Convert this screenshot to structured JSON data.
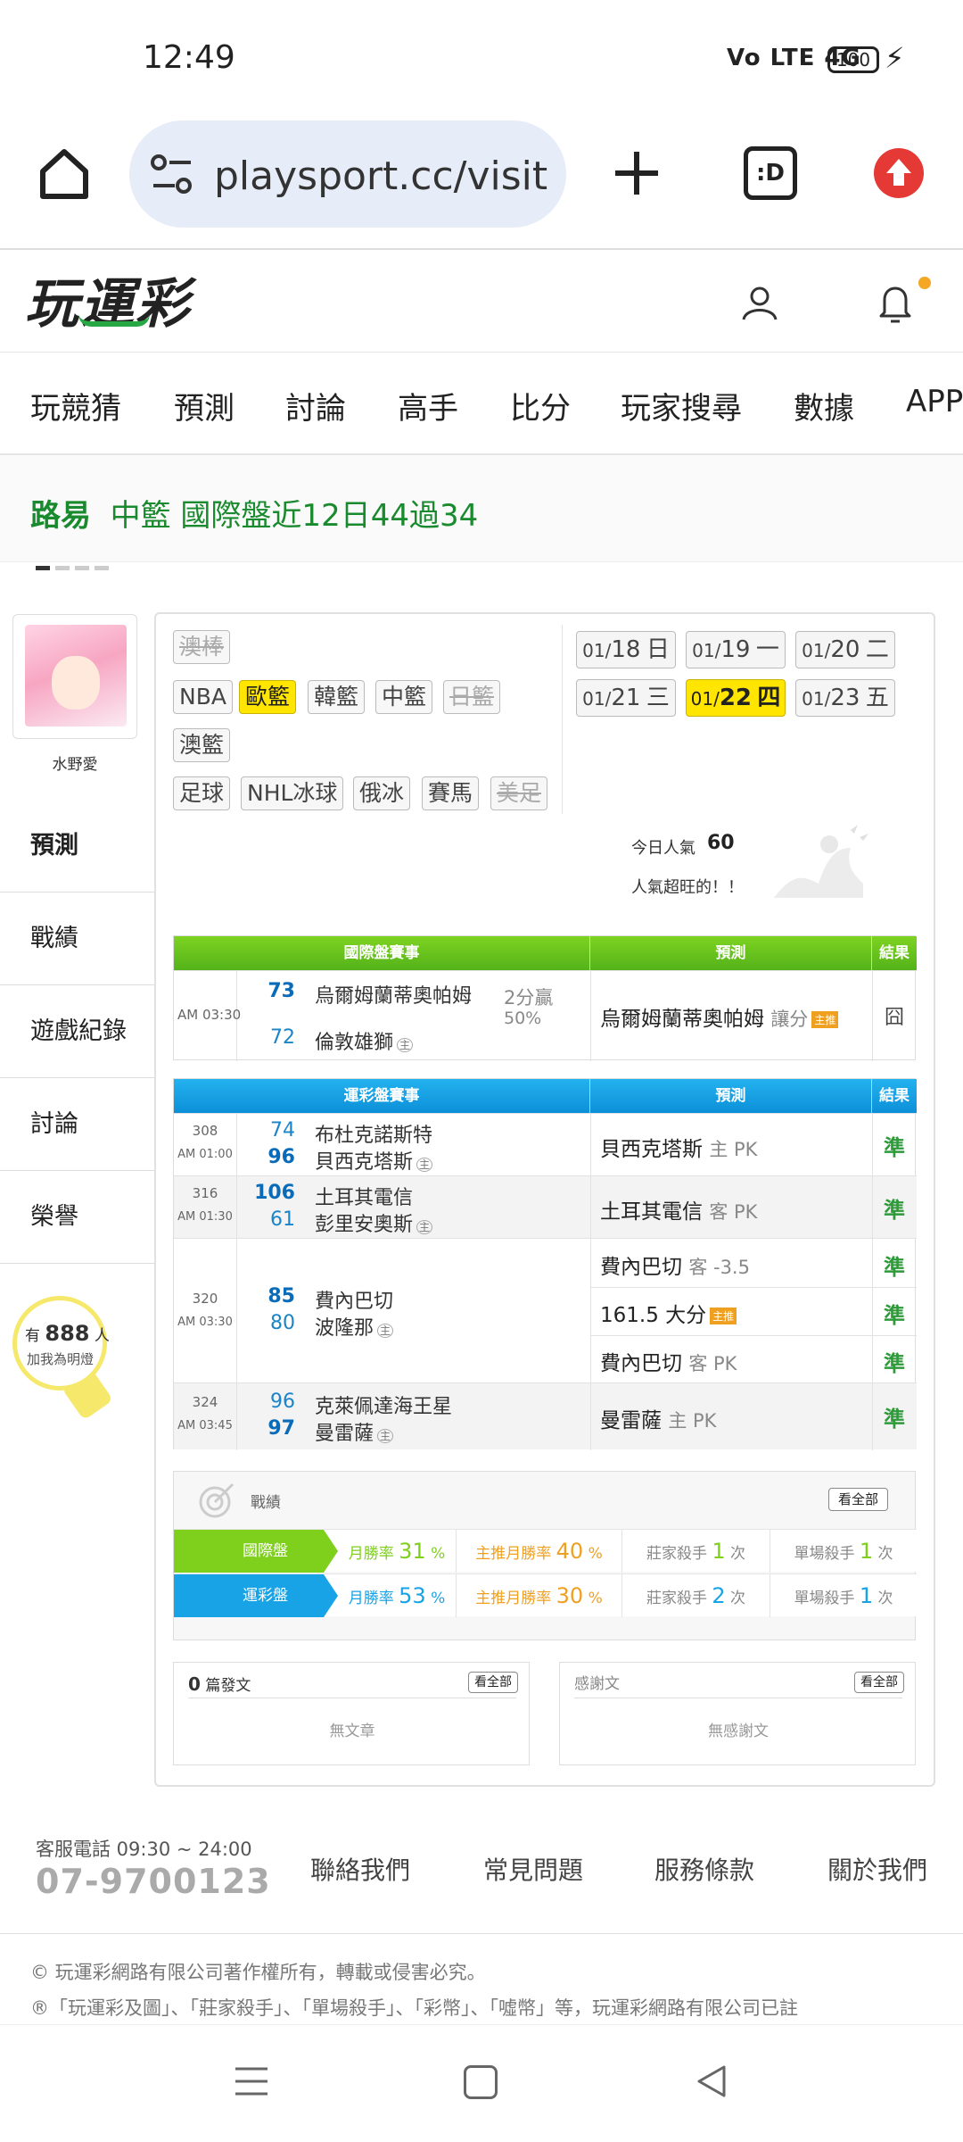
{
  "status_bar": {
    "time": "12:49",
    "signal": "Vo LTE 4G",
    "battery": "100"
  },
  "browser": {
    "url": "playsport.cc/visit"
  },
  "site": {
    "logo": "玩運彩"
  },
  "nav": [
    "玩競猜",
    "預測",
    "討論",
    "高手",
    "比分",
    "玩家搜尋",
    "數據",
    "APP"
  ],
  "marquee": {
    "prefix": "路易",
    "text": "中籃 國際盤近12日44過34"
  },
  "profile": {
    "name": "水野愛",
    "menu": [
      "預測",
      "戰績",
      "遊戲紀錄",
      "討論",
      "榮譽"
    ],
    "fans_prefix": "有",
    "fans_count": "888",
    "fans_suffix": "人",
    "fans_note": "加我為明燈"
  },
  "sports": {
    "row1": [
      "澳棒"
    ],
    "row2": [
      "NBA",
      "歐籃",
      "韓籃",
      "中籃",
      "日籃"
    ],
    "row3": [
      "澳籃"
    ],
    "row4": [
      "足球",
      "NHL冰球",
      "俄冰",
      "賽馬",
      "美足"
    ]
  },
  "dates": [
    {
      "md": "01/",
      "d": "18",
      "w": "日"
    },
    {
      "md": "01/",
      "d": "19",
      "w": "一"
    },
    {
      "md": "01/",
      "d": "20",
      "w": "二"
    },
    {
      "md": "01/",
      "d": "21",
      "w": "三"
    },
    {
      "md": "01/",
      "d": "22",
      "w": "四"
    },
    {
      "md": "01/",
      "d": "23",
      "w": "五"
    }
  ],
  "popularity": {
    "label": "今日人氣",
    "value": "60",
    "note": "人氣超旺的！！"
  },
  "intl_table": {
    "headers": [
      "國際盤賽事",
      "預測",
      "結果"
    ],
    "rows": [
      {
        "time": "AM 03:30",
        "away_score": "73",
        "away_team": "烏爾姆蘭蒂奧帕姆",
        "home_score": "72",
        "home_team": "倫敦雄獅",
        "home_mark": "主",
        "line": "2分贏",
        "line_pct": "50%",
        "pick": "烏爾姆蘭蒂奧帕姆",
        "pick_sub": "讓分",
        "tag": "主推",
        "result": "囧"
      }
    ]
  },
  "lottery_table": {
    "headers": [
      "運彩盤賽事",
      "預測",
      "結果"
    ],
    "rows": [
      {
        "no": "308",
        "time": "AM 01:00",
        "away_score": "74",
        "away_team": "布杜克諾斯特",
        "home_score": "96",
        "home_team": "貝西克塔斯",
        "home_mark": "主",
        "picks": [
          {
            "name": "貝西克塔斯",
            "sub": "主 PK",
            "tag": "",
            "result": "準"
          }
        ]
      },
      {
        "no": "316",
        "time": "AM 01:30",
        "away_score": "106",
        "away_team": "土耳其電信",
        "home_score": "61",
        "home_team": "彭里安奧斯",
        "home_mark": "主",
        "picks": [
          {
            "name": "土耳其電信",
            "sub": "客 PK",
            "tag": "",
            "result": "準"
          }
        ]
      },
      {
        "no": "320",
        "time": "AM 03:30",
        "away_score": "85",
        "away_team": "費內巴切",
        "home_score": "80",
        "home_team": "波隆那",
        "home_mark": "主",
        "picks": [
          {
            "name": "費內巴切",
            "sub": "客 -3.5",
            "tag": "",
            "result": "準"
          },
          {
            "name": "161.5 大分",
            "sub": "",
            "tag": "主推",
            "result": "準"
          },
          {
            "name": "費內巴切",
            "sub": "客 PK",
            "tag": "",
            "result": "準"
          }
        ]
      },
      {
        "no": "324",
        "time": "AM 03:45",
        "away_score": "96",
        "away_team": "克萊佩達海王星",
        "home_score": "97",
        "home_team": "曼雷薩",
        "home_mark": "主",
        "picks": [
          {
            "name": "曼雷薩",
            "sub": "主 PK",
            "tag": "",
            "result": "準"
          }
        ]
      }
    ]
  },
  "record": {
    "title": "戰績",
    "see_all": "看全部",
    "rows": [
      {
        "label": "國際盤",
        "month_label": "月勝率",
        "month_val": "31",
        "main_label": "主推月勝率",
        "main_val": "40",
        "pct": "%",
        "killer_label": "莊家殺手",
        "killer_val": "1",
        "single_label": "單場殺手",
        "single_val": "1",
        "unit": "次",
        "color": "#7fcf1d"
      },
      {
        "label": "運彩盤",
        "month_label": "月勝率",
        "month_val": "53",
        "main_label": "主推月勝率",
        "main_val": "30",
        "pct": "%",
        "killer_label": "莊家殺手",
        "killer_val": "2",
        "single_label": "單場殺手",
        "single_val": "1",
        "unit": "次",
        "color": "#17a3e6"
      }
    ]
  },
  "articles": {
    "count": "0",
    "label": "篇發文",
    "see_all": "看全部",
    "empty": "無文章"
  },
  "thanks": {
    "label": "感謝文",
    "see_all": "看全部",
    "empty": "無感謝文"
  },
  "footer": {
    "phone_label": "客服電話 09:30 ~ 24:00",
    "phone": "07-9700123",
    "links": [
      "聯絡我們",
      "常見問題",
      "服務條款",
      "關於我們"
    ],
    "copyright": "© 玩運彩網路有限公司著作權所有，轉載或侵害必究。",
    "trademark": "®「玩運彩及圖」、「莊家殺手」、「單場殺手」、「彩幣」、「噓幣」等，玩運彩網路有限公司已註"
  },
  "colors": {
    "brand_green": "#27a844",
    "highlight_yellow": "#ffe500",
    "intl_green": "#7ed321",
    "lottery_blue": "#17a3e6",
    "hit_green": "#2e9a3a"
  }
}
